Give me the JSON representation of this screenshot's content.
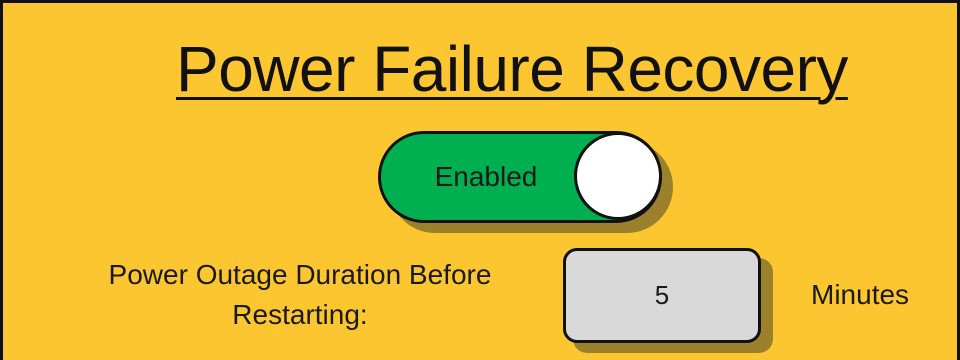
{
  "title": "Power Failure Recovery",
  "toggle": {
    "label": "Enabled",
    "state": "on"
  },
  "outage_duration": {
    "label_line1": "Power Outage Duration Before",
    "label_line2": "Restarting:",
    "value": "5",
    "unit": "Minutes"
  },
  "colors": {
    "background": "#fcc631",
    "toggle_on": "#00b050",
    "input_bg": "#d9d9d9"
  }
}
